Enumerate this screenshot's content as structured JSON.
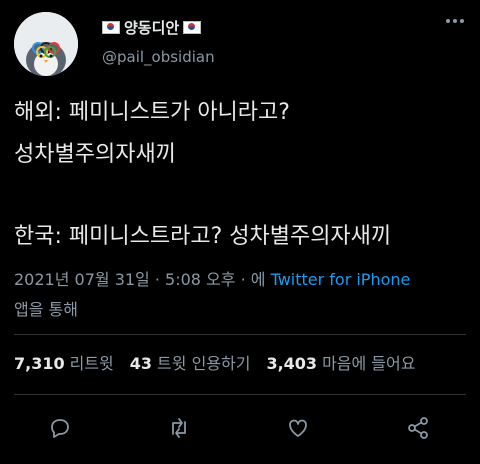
{
  "tweet": {
    "author": {
      "display_name": "양동디안",
      "handle": "@pail_obsidian",
      "flag_icon": "kr-flag-icon"
    },
    "line1": "해외: 페미니스트가 아니라고?",
    "line2": "성차별주의자새끼",
    "line3": "한국: 페미니스트라고? 성차별주의자새끼",
    "timestamp": "2021년 07월 31일 · 5:08 오후 · 에",
    "source": "Twitter for iPhone",
    "via": "앱을 통해",
    "stats": {
      "retweets": "7,310",
      "retweets_label": "리트윗",
      "quotes": "43",
      "quotes_label": "트윗 인용하기",
      "likes": "3,403",
      "likes_label": "마음에 들어요"
    }
  },
  "colors": {
    "background": "#000000",
    "text": "#e7e9ea",
    "secondary": "#8b98a5",
    "link": "#1d9bf0",
    "divider": "#2f3336"
  }
}
